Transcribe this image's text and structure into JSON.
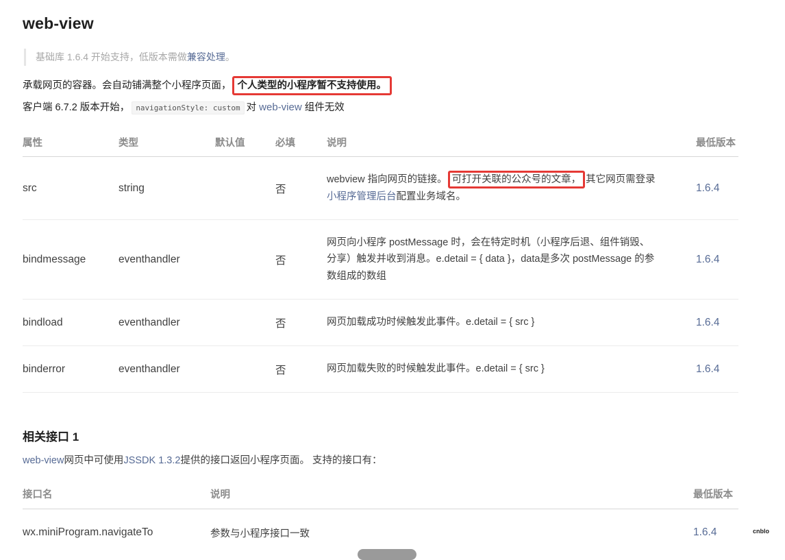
{
  "title": "web-view",
  "tip": {
    "text": "基础库 1.6.4 开始支持，低版本需做",
    "link": "兼容处理",
    "end": "。"
  },
  "intro": {
    "text": "承载网页的容器。会自动铺满整个小程序页面，",
    "highlight": "个人类型的小程序暂不支持使用。"
  },
  "nav_note": {
    "prefix": "客户端 6.7.2 版本开始，",
    "code": "navigationStyle: custom",
    "middle": "对",
    "link": "web-view",
    "suffix": "组件无效"
  },
  "props_table": {
    "headers": [
      "属性",
      "类型",
      "默认值",
      "必填",
      "说明",
      "最低版本"
    ],
    "rows": [
      {
        "name": "src",
        "type": "string",
        "default": "",
        "required": "否",
        "desc_pre": "webview 指向网页的链接。",
        "desc_highlight": "可打开关联的公众号的文章，",
        "desc_post": "其它网页需登录",
        "desc_link": "小程序管理后台",
        "desc_tail": "配置业务域名。",
        "version": "1.6.4"
      },
      {
        "name": "bindmessage",
        "type": "eventhandler",
        "default": "",
        "required": "否",
        "desc": "网页向小程序 postMessage 时，会在特定时机（小程序后退、组件销毁、分享）触发并收到消息。e.detail = { data }，data是多次 postMessage 的参数组成的数组",
        "version": "1.6.4"
      },
      {
        "name": "bindload",
        "type": "eventhandler",
        "default": "",
        "required": "否",
        "desc": "网页加载成功时候触发此事件。e.detail = { src }",
        "version": "1.6.4"
      },
      {
        "name": "binderror",
        "type": "eventhandler",
        "default": "",
        "required": "否",
        "desc": "网页加载失败的时候触发此事件。e.detail = { src }",
        "version": "1.6.4"
      }
    ]
  },
  "related": {
    "title": "相关接口 1",
    "line": {
      "link1": "web-view",
      "text1": "网页中可使用",
      "link2": "JSSDK 1.3.2",
      "text2": "提供的接口返回小程序页面。 支持的接口有："
    }
  },
  "api_table": {
    "headers": [
      "接口名",
      "说明",
      "最低版本"
    ],
    "rows": [
      {
        "name": "wx.miniProgram.navigateTo",
        "desc": "参数与小程序接口一致",
        "version": "1.6.4"
      }
    ]
  },
  "corner_logo": "cnblo"
}
